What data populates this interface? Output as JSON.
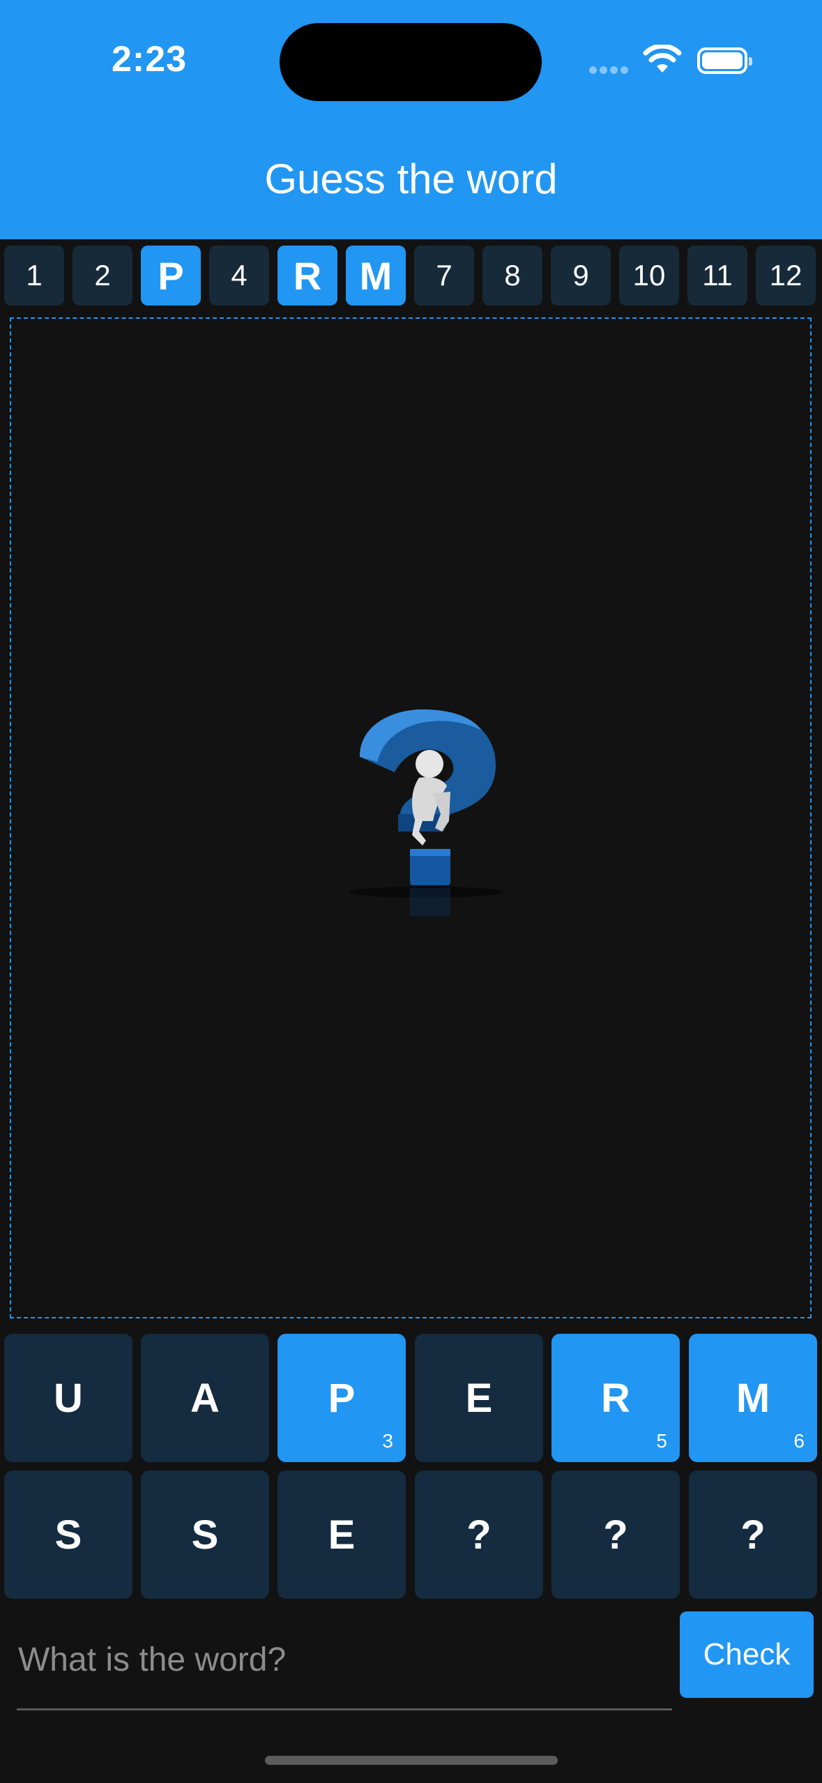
{
  "status_bar": {
    "time": "2:23"
  },
  "header": {
    "title": "Guess the word"
  },
  "slots": [
    "1",
    "2",
    "P",
    "4",
    "R",
    "M",
    "7",
    "8",
    "9",
    "10",
    "11",
    "12"
  ],
  "slot_active": [
    false,
    false,
    true,
    false,
    true,
    true,
    false,
    false,
    false,
    false,
    false,
    false
  ],
  "tiles_row1": [
    {
      "letter": "U",
      "num": ""
    },
    {
      "letter": "A",
      "num": ""
    },
    {
      "letter": "P",
      "num": "3"
    },
    {
      "letter": "E",
      "num": ""
    },
    {
      "letter": "R",
      "num": "5"
    },
    {
      "letter": "M",
      "num": "6"
    }
  ],
  "tiles_row2": [
    {
      "letter": "S",
      "num": ""
    },
    {
      "letter": "S",
      "num": ""
    },
    {
      "letter": "E",
      "num": ""
    },
    {
      "letter": "?",
      "num": ""
    },
    {
      "letter": "?",
      "num": ""
    },
    {
      "letter": "?",
      "num": ""
    }
  ],
  "input": {
    "value": "",
    "placeholder": "What is the word?"
  },
  "check_button": {
    "label": "Check"
  },
  "colors": {
    "accent": "#2196F3",
    "tile": "#142B40",
    "background": "#121212"
  }
}
